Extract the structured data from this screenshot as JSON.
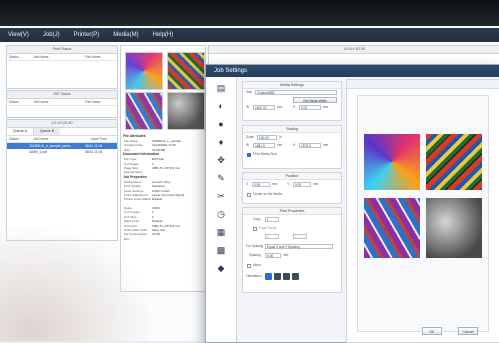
{
  "menu": [
    "View(V)",
    "Job(J)",
    "Printer(P)",
    "Media(M)",
    "Help(H)"
  ],
  "left": {
    "print_status": "Print Status",
    "rip_status": "RIP Status",
    "status_hdr": [
      "Status",
      "Job Name",
      "File Name"
    ],
    "printer_name": "UJ LH VD 80",
    "queues": [
      "Queue A",
      "Queue B"
    ],
    "list_hdr": [
      "Status",
      "Job Name",
      "Input Time"
    ],
    "jobs": [
      {
        "name": "2018MUA_h_sample_parts...",
        "time": "08/11 11:04"
      },
      {
        "name": "3d4fb_1.pdf",
        "time": "08/11 11:04"
      }
    ]
  },
  "middle": {
    "file_attr": "File Attributes",
    "file_rows": [
      [
        "File Name",
        "2018MUA_h_sample..."
      ],
      [
        "Creation Date",
        "11/19/2018 13:15"
      ],
      [
        "Size",
        "21.98 MB"
      ]
    ],
    "doc_info": "Document Information",
    "doc_rows": [
      [
        "File Type",
        "EPS File"
      ],
      [
        "# of Pages",
        "1"
      ],
      [
        "Page Size",
        "1881.5 x 1578.9 mm"
      ],
      [
        "Special Items",
        ""
      ]
    ],
    "job_props": "Job Properties",
    "job_rows": [
      [
        "Media Name",
        "Generic Vinyl"
      ],
      [
        "Print Quality",
        "Standard"
      ],
      [
        "Color Settings",
        "KCMY-Lc/Lm"
      ],
      [
        "Color Adjustment",
        "Linear (No Color Mgmt)"
      ],
      [
        "Printer Color Match",
        "Disable"
      ],
      [
        "",
        ""
      ],
      [
        "Scale",
        "100%"
      ],
      [
        "# of Copies",
        "1"
      ],
      [
        "# of Tiles",
        "1"
      ],
      [
        "Mark Color",
        "Disable"
      ],
      [
        "Print Size",
        "1881.5 x 1578.9 mm"
      ],
      [
        "Action After Print",
        "Save Job"
      ],
      [
        "Ink Consumption Est...",
        "18.48"
      ]
    ]
  },
  "right_title": "UJ LH VD 80",
  "dialog": {
    "title": "Job Settings",
    "media": {
      "title": "Media Settings",
      "size_label": "Size",
      "size_value": "Custom8552",
      "get_width": "Get Media Width",
      "w_label": "W",
      "w_value": "1600.00",
      "h_label": "H",
      "h_value": "0.00",
      "unit": "mm"
    },
    "scaling": {
      "title": "Scaling",
      "scale_label": "Scale",
      "scale_value": "100.00",
      "pct": "%",
      "w_value": "1881.5",
      "h_value": "1578.9",
      "fit": "Fit to Media Size"
    },
    "position": {
      "title": "Position",
      "x_value": "0.00",
      "y_value": "0.00",
      "center": "Center on the Media"
    },
    "print_props": {
      "title": "Print Properties",
      "copy_label": "Copy",
      "copy_value": "1",
      "page_range": "Page Range",
      "from_value": "1",
      "to_value": "1",
      "spacing_mode_label": "For Spacing",
      "spacing_mode": "Equal X and Y Spacing",
      "spacing_label": "Spacing",
      "spacing_value": "0.00",
      "mirror": "Mirror",
      "orientation": "Orientation"
    },
    "ok": "OK",
    "cancel": "Cancel"
  },
  "colors": {
    "menubar": "#22303f",
    "titlebar": "#253e5c",
    "selection": "#3e7ad6"
  }
}
